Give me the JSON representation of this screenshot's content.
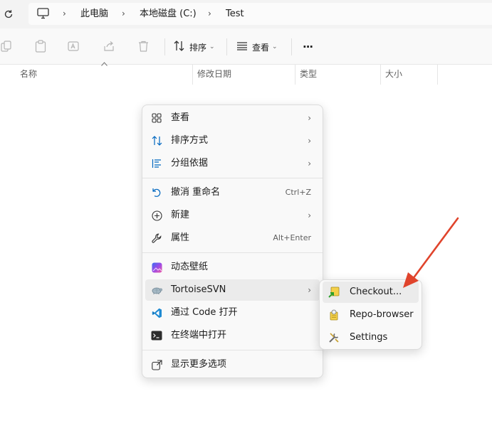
{
  "address_bar": {
    "crumbs": [
      "此电脑",
      "本地磁盘 (C:)",
      "Test"
    ],
    "separator": "›"
  },
  "toolbar": {
    "sort_label": "排序",
    "view_label": "查看",
    "more_label": "···",
    "caret": "⌄"
  },
  "columns": [
    "名称",
    "修改日期",
    "类型",
    "大小"
  ],
  "context_menu": {
    "items": [
      {
        "label": "查看",
        "icon": "grid-view-icon",
        "arrow": "›"
      },
      {
        "label": "排序方式",
        "icon": "sort-icon",
        "arrow": "›"
      },
      {
        "label": "分组依据",
        "icon": "group-list-icon",
        "arrow": "›"
      },
      {
        "label": "撤消 重命名",
        "icon": "undo-icon",
        "shortcut": "Ctrl+Z"
      },
      {
        "label": "新建",
        "icon": "new-plus-icon",
        "arrow": "›"
      },
      {
        "label": "属性",
        "icon": "wrench-icon",
        "shortcut": "Alt+Enter"
      },
      {
        "label": "动态壁纸",
        "icon": "wallpaper-icon"
      },
      {
        "label": "TortoiseSVN",
        "icon": "tortoise-icon",
        "arrow": "›"
      },
      {
        "label": "通过 Code 打开",
        "icon": "vscode-icon"
      },
      {
        "label": "在终端中打开",
        "icon": "terminal-icon"
      },
      {
        "label": "显示更多选项",
        "icon": "more-options-icon"
      }
    ]
  },
  "submenu": {
    "items": [
      {
        "label": "Checkout...",
        "icon": "svn-checkout-icon"
      },
      {
        "label": "Repo-browser",
        "icon": "repo-browser-icon"
      },
      {
        "label": "Settings",
        "icon": "settings-tools-icon"
      }
    ]
  },
  "colors": {
    "accent": "#0067c0",
    "annotation_arrow": "#e0442c",
    "menu_bg": "#f9f9f9",
    "hover_bg": "#ebebeb"
  }
}
